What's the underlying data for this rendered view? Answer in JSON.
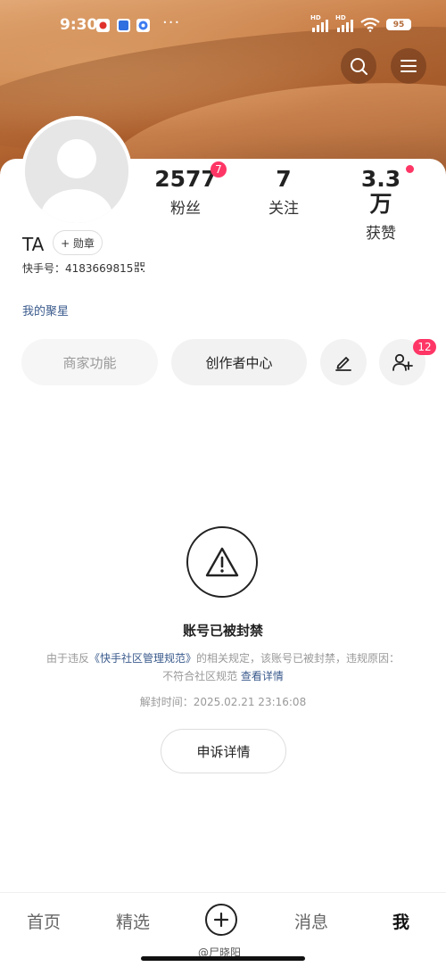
{
  "status_bar": {
    "time": "9:30",
    "more_dots": "···",
    "battery": "95"
  },
  "profile": {
    "name": "TA",
    "medal_label": "+ 勋章",
    "uid": "快手号：4183669815",
    "star_link": "我的聚星",
    "stats": [
      {
        "value": "2577",
        "label": "粉丝",
        "badge": "7"
      },
      {
        "value": "7",
        "label": "关注"
      },
      {
        "value": "3.3万",
        "label": "获赞"
      }
    ]
  },
  "actions": {
    "merchant": "商家功能",
    "creator": "创作者中心",
    "add_friend_badge": "12"
  },
  "ban": {
    "title": "账号已被封禁",
    "desc_1": "由于违反",
    "desc_link": "《快手社区管理规范》",
    "desc_2": "的相关规定，该账号已被封禁，违规原因：不符合社区规范",
    "desc_more": "查看详情",
    "unban_time": "解封时间：2025.02.21 23:16:08",
    "appeal_button": "申诉详情"
  },
  "nav": {
    "home": "首页",
    "featured": "精选",
    "messages": "消息",
    "me": "我"
  },
  "watermark": "@尸晓阳"
}
